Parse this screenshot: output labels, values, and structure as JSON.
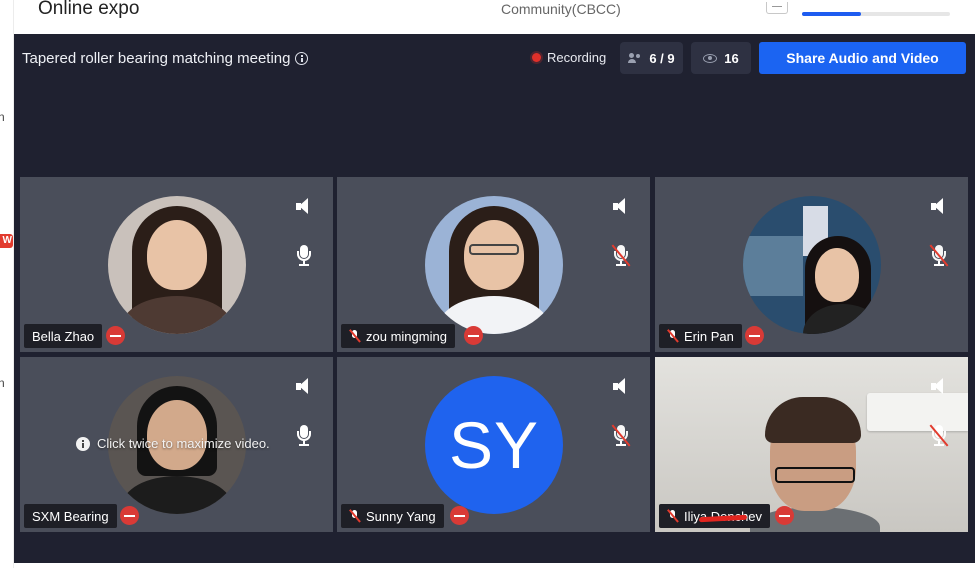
{
  "header": {
    "app_title": "Online expo",
    "org_name": "Community(CBCC)",
    "progress_fraction": 0.4
  },
  "left_strip": {
    "char_1": "n",
    "badge_text": "W",
    "char_2": "n"
  },
  "meeting": {
    "title": "Tapered roller bearing matching meeting",
    "recording_label": "Recording",
    "participants_count": "6 / 9",
    "viewers_count": "16",
    "share_button_label": "Share Audio and Video",
    "colors": {
      "accent": "#1b64f2",
      "record": "#e0302a",
      "remove": "#d93a36",
      "panel_bg": "#1f2130",
      "tile_bg": "#4a4e5a"
    }
  },
  "participants": [
    {
      "name": "Bella Zhao",
      "mic_muted": false,
      "avatar": "photo"
    },
    {
      "name": "zou mingming",
      "mic_muted": true,
      "avatar": "photo"
    },
    {
      "name": "Erin Pan",
      "mic_muted": true,
      "avatar": "photo"
    },
    {
      "name": "SXM Bearing",
      "mic_muted": false,
      "avatar": "photo",
      "hint": "Click twice to maximize video."
    },
    {
      "name": "Sunny Yang",
      "mic_muted": true,
      "avatar": "initials",
      "initials": "SY"
    },
    {
      "name": "Iliya Donchev",
      "mic_muted": true,
      "avatar": "camera"
    }
  ],
  "icons": {
    "info": "info-icon",
    "people": "people-icon",
    "eye": "eye-icon",
    "speaker": "speaker-icon",
    "mic": "microphone-icon",
    "mic_muted": "microphone-muted-icon",
    "remove": "remove-icon"
  }
}
